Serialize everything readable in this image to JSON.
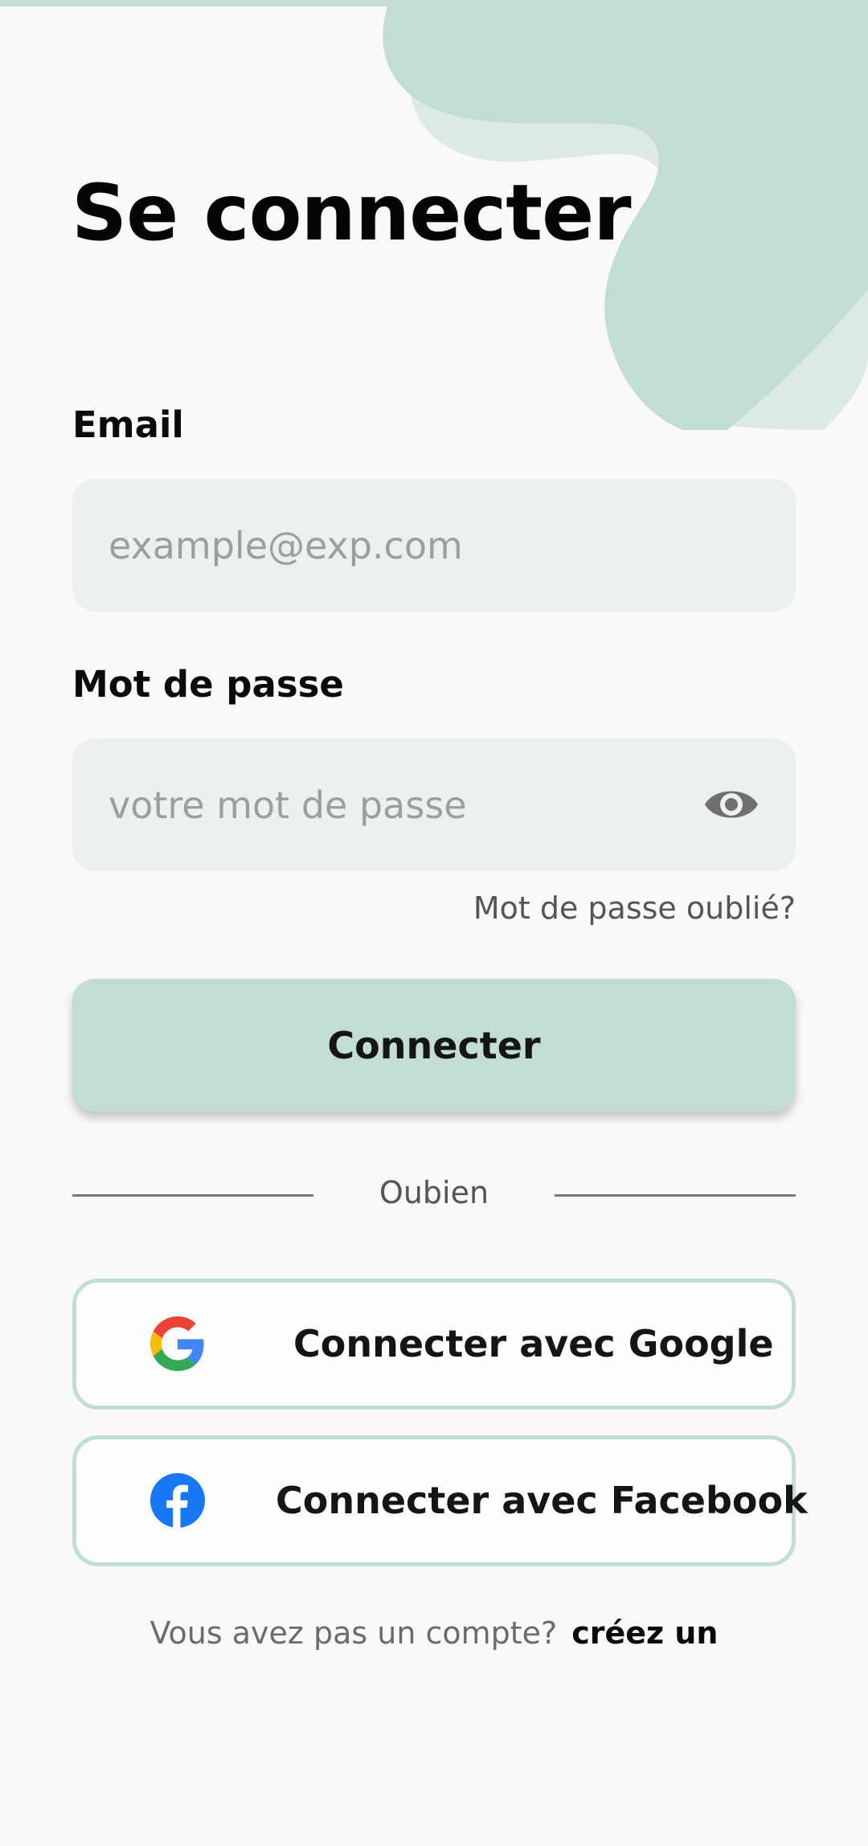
{
  "page": {
    "title": "Se connecter"
  },
  "email": {
    "label": "Email",
    "placeholder": "example@exp.com",
    "value": ""
  },
  "password": {
    "label": "Mot de passe",
    "placeholder": "votre mot de passe",
    "value": "",
    "toggle_icon": "eye-icon"
  },
  "forgot_password": "Mot de passe oublié?",
  "login_button": "Connecter",
  "divider_text": "Oubien",
  "social": {
    "google": {
      "label": "Connecter avec Google",
      "icon": "google-icon"
    },
    "facebook": {
      "label": "Connecter avec Facebook",
      "icon": "facebook-icon"
    }
  },
  "signup": {
    "question": "Vous avez pas un compte?",
    "link": "créez un"
  },
  "colors": {
    "accent": "#c2ddd2",
    "accent_light": "#dce9e4",
    "field_bg": "#ecf1ee",
    "background": "#f9f9f9",
    "facebook": "#1877f2"
  }
}
